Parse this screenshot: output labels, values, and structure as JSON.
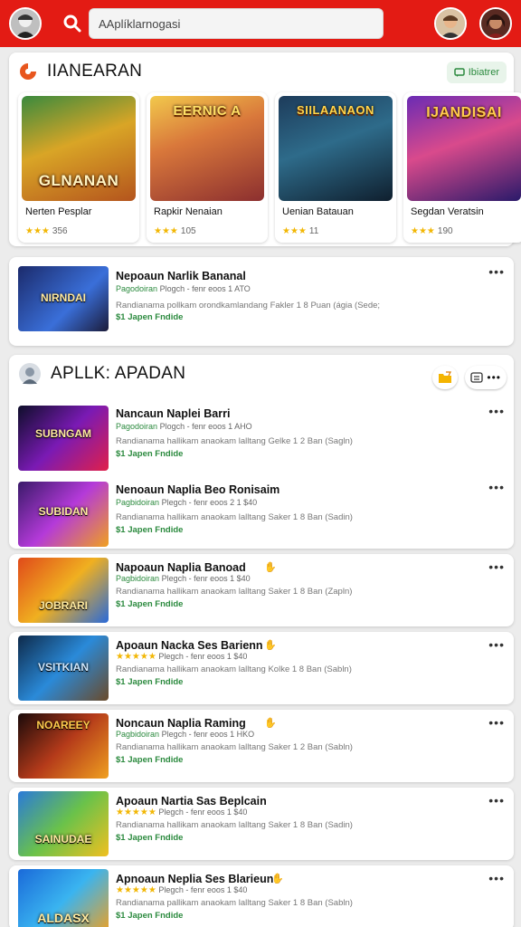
{
  "header": {
    "search_placeholder": "AAplíklarnogasi",
    "colors": {
      "bar": "#e31b14"
    }
  },
  "featured": {
    "title": "IIANEARAN",
    "badge": "Ibiatrer",
    "tiles": [
      {
        "art": "GLNANAN",
        "name": "Nerten Pesplar",
        "rating": "356"
      },
      {
        "art": "EERNIC A",
        "name": "Rapkir Nenaian",
        "rating": "105"
      },
      {
        "art": "SIILAANAON",
        "name": "Uenian Batauan",
        "rating": "11"
      },
      {
        "art": "IJANDISAI",
        "name": "Segdan Veratsin",
        "rating": "190"
      }
    ]
  },
  "single": {
    "art": "NIRNDAI",
    "title": "Nepoaun Narlik Bananal",
    "meta_green": "Pagodoiran",
    "meta": "Plogch - fenr eoos 1 ATO",
    "desc": "Randianama pollkam orondkamlandang Fakler 1 8 Puan (ágia (Sede;",
    "price": "$1 Japen Fndide"
  },
  "list": {
    "title": "APLLK: APADAN",
    "items": [
      {
        "art": "SUBNGAM",
        "title": "Nancaun Naplei Barri",
        "meta_green": "Pagodoiran",
        "meta": "Plogch - fenr eoos 1 AHO",
        "desc": "Randianama hallikam anaokam lalltang Gelke 1 2 Ban (Sagln)",
        "price": "$1 Japen Fndide"
      },
      {
        "art": "SUBIDAN",
        "title": "Nenoaun Naplia Beo Ronisaim",
        "meta_green": "Pagbidoiran",
        "meta": "Plegch - fenr eoos 2 1 $40",
        "desc": "Randianama hallikam anaokam lalltang Saker 1 8 Ban (Sadin)",
        "price": "$1 Japen Fndide"
      }
    ]
  },
  "items": [
    {
      "art": "JOBRARI",
      "title": "Napoaun Naplia Banoad",
      "meta_green": "Pagbidoiran",
      "meta": "Plegch - fenr eoos 1 $40",
      "desc": "Randianama hallikam anaokam lalltang Saker 1 8 Ban (Zapln)",
      "price": "$1 Japen Fndide"
    },
    {
      "art": "VSITKIAN",
      "title": "Apoaun Nacka Ses Barienn",
      "stars": "★★★★★",
      "meta": "Plegch - fenr eoos 1 $40",
      "desc": "Randianama hallikam anaokam lalltang Kolke 1 8 Ban (Sabln)",
      "price": "$1 Japen Fndide"
    },
    {
      "art": "NOAREEY",
      "title": "Noncaun Naplia Raming",
      "meta_green": "Pagbidoiran",
      "meta": "Plegch - fenr eoos 1 HKO",
      "desc": "Randianama hallikam anaokam lalltang Saker 1 2 Ban (Sabln)",
      "price": "$1 Japen Fndide"
    },
    {
      "art": "SAINUDAE",
      "title": "Apoaun Nartia Sas Beplcain",
      "stars": "★★★★★",
      "meta": "Plegch - fenr eoos 1 $40",
      "desc": "Randianama hallikam anaokam lalltang Saker 1 8 Ban (Sadin)",
      "price": "$1 Japen Fndide"
    },
    {
      "art": "ALDASX",
      "title": "Apnoaun Neplia Ses Blarieun",
      "stars": "★★★★★",
      "meta": "Plegch - fenr eoos 1 $40",
      "desc": "Randianama pallikam anaokam lalltang Saker 1 8 Ban (Sabln)",
      "price": "$1 Japen Fndide"
    }
  ]
}
